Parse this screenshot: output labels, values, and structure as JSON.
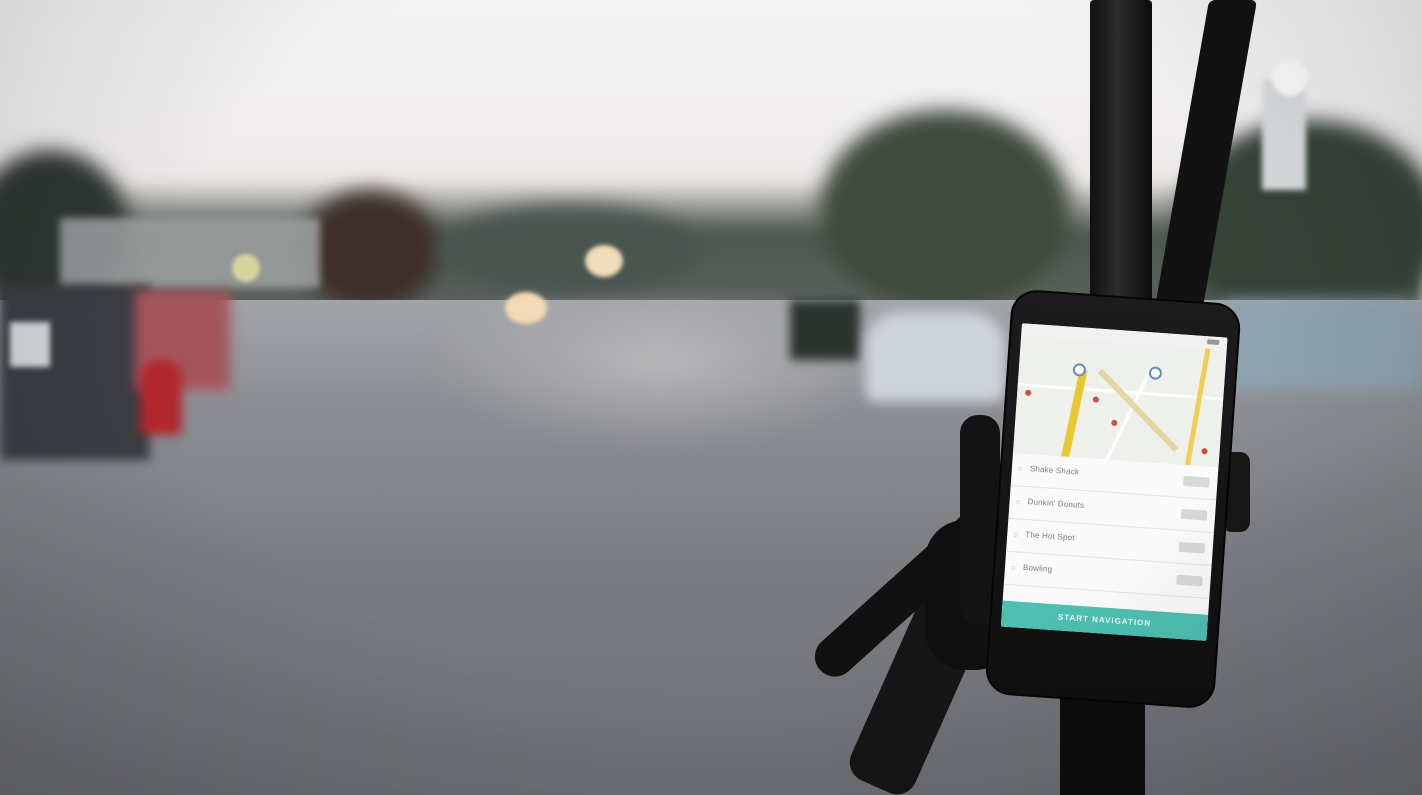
{
  "phone_app": {
    "map": {
      "search_hint": "",
      "pins": 4
    },
    "locations": [
      {
        "label": "Shake Shack",
        "action": ""
      },
      {
        "label": "Dunkin' Donuts",
        "action": ""
      },
      {
        "label": "The Hot Spot",
        "action": ""
      },
      {
        "label": "Bowling",
        "action": ""
      }
    ],
    "start_button": "START NAVIGATION",
    "accent_color": "#4dc0b2"
  }
}
